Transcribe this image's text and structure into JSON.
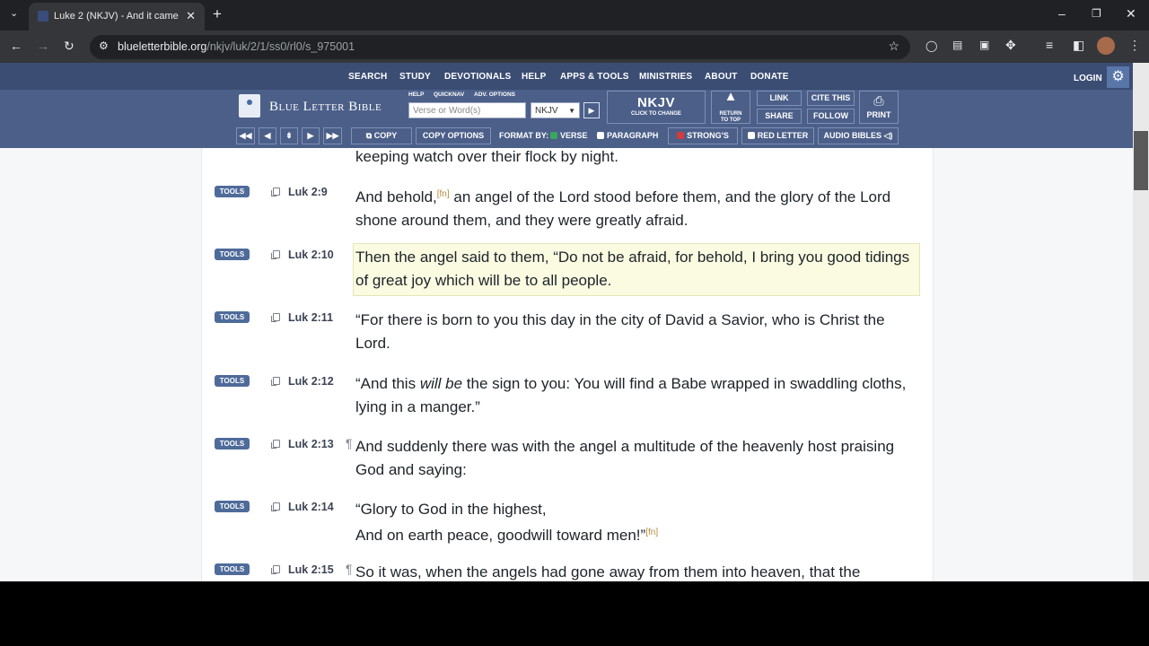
{
  "browser": {
    "tab_title": "Luke 2 (NKJV) - And it came to",
    "new_tab": "+",
    "url_host": "blueletterbible.org",
    "url_path": "/nkjv/luk/2/1/ss0/rl0/s_975001"
  },
  "nav": {
    "items": [
      "SEARCH",
      "STUDY",
      "DEVOTIONALS",
      "HELP",
      "APPS & TOOLS",
      "MINISTRIES",
      "ABOUT",
      "DONATE"
    ],
    "login": "LOGIN"
  },
  "header": {
    "logo_text": "Blue Letter Bible",
    "mini_links": [
      "HELP",
      "QUICKNAV",
      "ADV. OPTIONS"
    ],
    "search_placeholder": "Verse or Word(s)",
    "version": "NKJV",
    "version_big": "NKJV",
    "version_small": "CLICK TO CHANGE",
    "return_top_1": "RETURN",
    "return_top_2": "TO TOP",
    "link": "LINK",
    "cite": "CITE THIS",
    "share": "SHARE",
    "follow": "FOLLOW",
    "print": "PRINT"
  },
  "subbar": {
    "copy": "COPY",
    "copy_options": "COPY OPTIONS",
    "format_by": "FORMAT BY:",
    "verse": "VERSE",
    "paragraph": "PARAGRAPH",
    "strongs": "STRONG'S",
    "red_letter": "RED LETTER",
    "audio": "AUDIO BIBLES"
  },
  "verses": {
    "tools_label": "TOOLS",
    "fn_marker": "[fn]",
    "v8_tail": "keeping watch over their flock by night.",
    "v9_ref": "Luk 2:9",
    "v9_a": "And behold,",
    "v9_b": " an angel of the Lord stood before them, and the glory of the Lord shone around them, and they were greatly afraid.",
    "v10_ref": "Luk 2:10",
    "v10": "Then the angel said to them, “Do not be afraid, for behold, I bring you good tidings of great joy which will be to all people.",
    "v11_ref": "Luk 2:11",
    "v11": "“For there is born to you this day in the city of David a Savior, who is Christ the Lord.",
    "v12_ref": "Luk 2:12",
    "v12_a": "“And this ",
    "v12_i": "will be",
    "v12_b": " the sign to you: You will find a Babe wrapped in swaddling cloths, lying in a manger.”",
    "v13_ref": "Luk 2:13",
    "v13": "And suddenly there was with the angel a multitude of the heavenly host praising God and saying:",
    "v14_ref": "Luk 2:14",
    "v14_l1": "“Glory to God in the highest,",
    "v14_l2": "And on earth peace, goodwill toward men!”",
    "v15_ref": "Luk 2:15",
    "v15": "So it was, when the angels had gone away from them into heaven, that the",
    "pilcrow": "¶"
  }
}
